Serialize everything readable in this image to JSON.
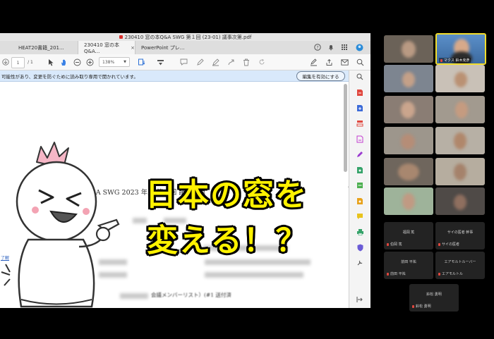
{
  "window": {
    "title": "230410 窓の本Q&A SWG 第１回 (23-01) 議事次第.pdf",
    "tabs": [
      {
        "label": "HEAT20書籍_201..."
      },
      {
        "label": "230410 窓の本Q&A..."
      },
      {
        "label": "PowerPoint プレ..."
      }
    ],
    "tab_close": "×"
  },
  "toolbar": {
    "page_current": "1",
    "page_total": "/ 1",
    "zoom": "138%"
  },
  "infobar": {
    "message": "可能性があり、変更を防ぐために読み取り専用で開かれています。",
    "enable_button": "編集を有効にする"
  },
  "document": {
    "heading": "窓の本  Q&A SWG    2023 年度  第１回  議事次第",
    "side_link": "了解",
    "footer_line": "会議メンバーリスト）(#1 送付済"
  },
  "overlay": {
    "line1": "日本の窓を",
    "line2": "変える！？"
  },
  "participants": {
    "speaker_label": "マクス  鈴木克彦",
    "name_tiles": [
      {
        "name": "福岡  篤",
        "sub": "伯岡  篤"
      },
      {
        "name": "サイの医者  幹事",
        "sub": "サイの医者"
      },
      {
        "name": "前田  平祐",
        "sub": "前田  平祐"
      },
      {
        "name": "エアモルトルーバー",
        "sub": "エアモルトル"
      },
      {
        "name": "鈴松  勇明",
        "sub": "鈴松  勇明"
      }
    ]
  },
  "colors": {
    "caption": "#fff200",
    "infobar": "#d9e9fb",
    "speaker_border": "#f2dd2c"
  }
}
